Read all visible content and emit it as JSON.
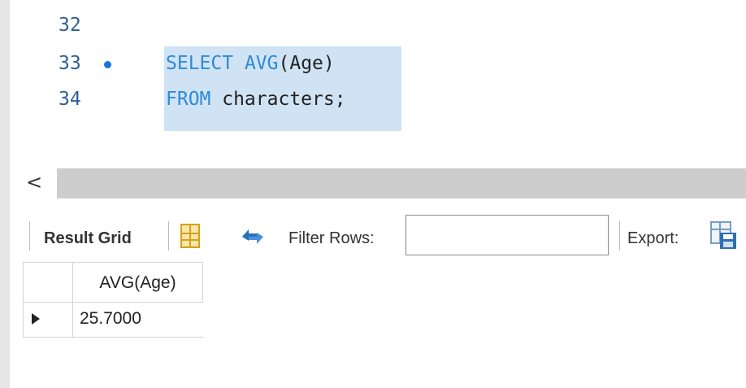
{
  "editor": {
    "lines": [
      {
        "number": "32",
        "keyword1": "",
        "mid": "",
        "keyword2": "",
        "rest": ""
      },
      {
        "number": "33",
        "keyword1": "SELECT",
        "mid": " ",
        "keyword2": "AVG",
        "rest": "(Age)"
      },
      {
        "number": "34",
        "keyword1": "FROM",
        "mid": " characters;",
        "keyword2": "",
        "rest": ""
      }
    ],
    "colors": {
      "keyword": "#2f8bd6",
      "line_number": "#2c5f95",
      "selection": "#cfe3f5",
      "breakpoint": "#1a73d9"
    }
  },
  "scrollbar": {
    "left_arrow": "<"
  },
  "toolbar": {
    "result_grid_label": "Result Grid",
    "grid_icon": "grid-icon",
    "refresh_icon": "refresh-icon",
    "filter_label": "Filter Rows:",
    "filter_value": "",
    "export_label": "Export:",
    "export_icon": "export-icon"
  },
  "result": {
    "columns": [
      "AVG(Age)"
    ],
    "rows": [
      [
        "25.7000"
      ]
    ]
  }
}
